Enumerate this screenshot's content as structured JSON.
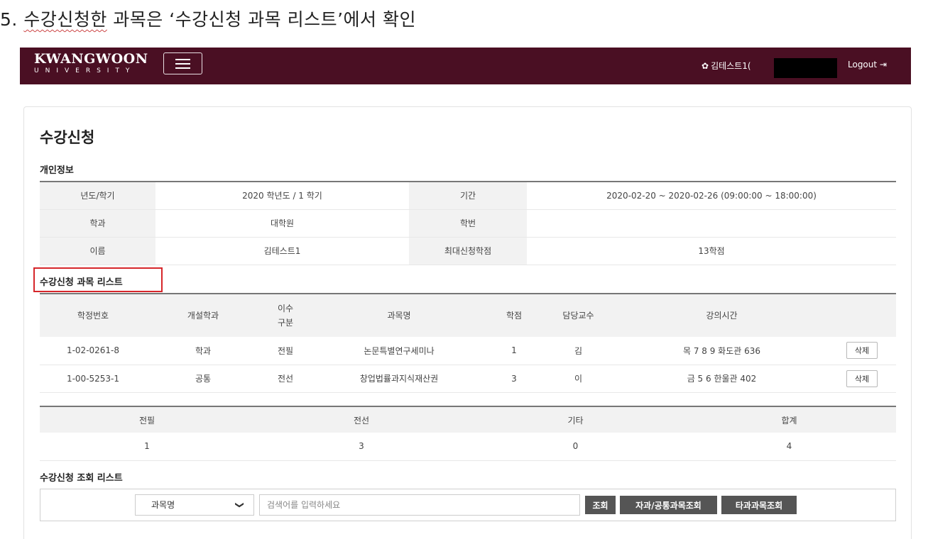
{
  "caption": {
    "prefix": "5. ",
    "underlined": "수강신청한",
    "rest": " 과목은 ‘수강신청 과목 리스트’에서 확인"
  },
  "navbar": {
    "logo_main": "KWANGWOON",
    "logo_sub": "UNIVERSITY",
    "user_name": "김테스트1(",
    "logout_label": "Logout"
  },
  "page": {
    "title": "수강신청",
    "personal_section": "개인정보",
    "course_list_section": "수강신청 과목 리스트",
    "search_list_section": "수강신청 조회 리스트"
  },
  "info": {
    "year_label": "년도/학기",
    "year_value": "2020 학년도 / 1 학기",
    "period_label": "기간",
    "period_value": "2020-02-20 ~ 2020-02-26 (09:00:00 ~ 18:00:00)",
    "dept_label": "학과",
    "dept_value": "대학원",
    "id_label": "학번",
    "id_value": "",
    "name_label": "이름",
    "name_value": "김테스트1",
    "max_credit_label": "최대신청학점",
    "max_credit_value": "13학점"
  },
  "course_table": {
    "headers": [
      "학정번호",
      "개설학과",
      "이수구분",
      "과목명",
      "학점",
      "담당교수",
      "강의시간"
    ],
    "header_type_line1": "이수",
    "header_type_line2": "구분",
    "rows": [
      {
        "code": "1-02-0261-8",
        "dept": "학과",
        "type": "전필",
        "name": "논문특별연구세미나",
        "credit": "1",
        "prof": "김",
        "time": "목 7 8 9 화도관 636",
        "action": "삭제"
      },
      {
        "code": "1-00-5253-1",
        "dept": "공통",
        "type": "전선",
        "name": "창업법률과지식재산권",
        "credit": "3",
        "prof": "이",
        "time": "금 5 6 한울관 402",
        "action": "삭제"
      }
    ]
  },
  "summary": {
    "headers": [
      "전필",
      "전선",
      "기타",
      "합계"
    ],
    "values": [
      "1",
      "3",
      "0",
      "4"
    ]
  },
  "search": {
    "select_value": "과목명",
    "placeholder": "검색어를 입력하세요",
    "search_btn": "조회",
    "own_dept_btn": "자과/공통과목조회",
    "other_dept_btn": "타과과목조회"
  }
}
